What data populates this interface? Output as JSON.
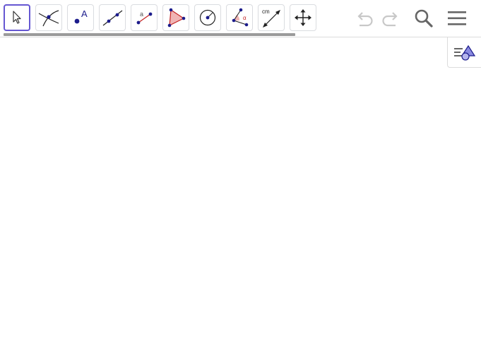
{
  "toolbar": {
    "tools": [
      {
        "name": "move-tool",
        "icon": "arrow-cursor-icon",
        "selected": true
      },
      {
        "name": "intersect-tool",
        "icon": "intersect-icon"
      },
      {
        "name": "point-tool",
        "icon": "point-icon",
        "label": "A"
      },
      {
        "name": "line-tool",
        "icon": "line-icon"
      },
      {
        "name": "segment-length-tool",
        "icon": "segment-icon",
        "label": "a"
      },
      {
        "name": "polygon-tool",
        "icon": "polygon-icon"
      },
      {
        "name": "circle-tool",
        "icon": "circle-center-point-icon"
      },
      {
        "name": "angle-tool",
        "icon": "angle-icon",
        "label": "α"
      },
      {
        "name": "distance-tool",
        "icon": "distance-icon",
        "label": "cm"
      },
      {
        "name": "move-graphics-tool",
        "icon": "move-graphics-icon"
      }
    ],
    "undo_icon": "undo-icon",
    "redo_icon": "redo-icon",
    "search_icon": "search-icon",
    "menu_icon": "menu-icon"
  },
  "algebra_toggle": {
    "icon": "algebra-view-icon"
  },
  "colors": {
    "accent": "#6557d2",
    "point": "#1c1c8c",
    "polygon_fill": "#f0b4b4",
    "icon_gray": "#666666"
  }
}
